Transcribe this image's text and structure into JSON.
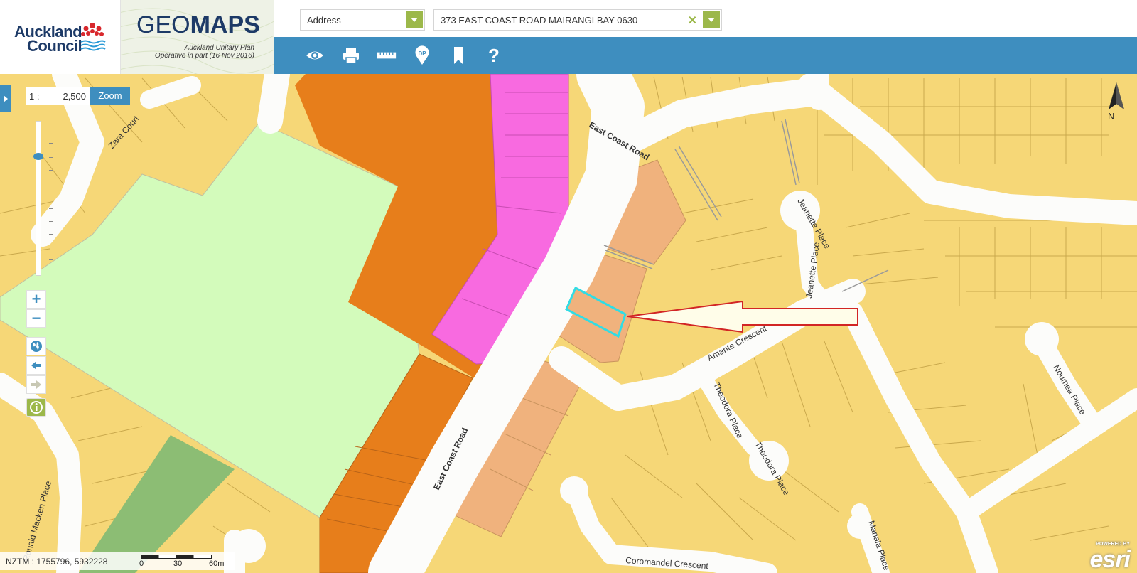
{
  "header": {
    "council_line1": "Auckland",
    "council_line2": "Council",
    "app_title_light": "GEO",
    "app_title_bold": "MAPS",
    "plan_line1": "Auckland Unitary Plan",
    "plan_line2": "Operative in part (16 Nov 2016)"
  },
  "search": {
    "type_value": "Address",
    "query_value": "373 EAST COAST ROAD MAIRANGI BAY 0630"
  },
  "toolbar": {
    "icons": [
      "eye-icon",
      "print-icon",
      "ruler-icon",
      "dp-pin-icon",
      "bookmark-icon",
      "help-icon"
    ],
    "dp_label": "DP",
    "help_label": "?"
  },
  "map_controls": {
    "scale_prefix": "1 :",
    "scale_value": "2,500",
    "zoom_label": "Zoom",
    "zoom_in": "+",
    "zoom_out": "−",
    "north_label": "N"
  },
  "map_labels": {
    "zara_court": "Zara Court",
    "east_coast_road_top": "East Coast Road",
    "east_coast_road_bottom": "East Coast Road",
    "jeanette_place_circle": "Jeanette Place",
    "jeanette_place": "Jeanette Place",
    "amante_crescent": "Amante Crescent",
    "theodora_place": "Theodora Place",
    "theodora_place_circle": "Theodora Place",
    "noumea_place": "Noumea Place",
    "ronald_macken_place": "Ronald Macken Place",
    "coromandel_crescent": "Coromandel Crescent",
    "manaia_place": "Manaia Place"
  },
  "status": {
    "coords": "NZTM : 1755796, 5932228",
    "scalebar_0": "0",
    "scalebar_30": "30",
    "scalebar_60": "60m"
  },
  "branding": {
    "esri_powered": "POWERED BY",
    "esri_word": "esri"
  },
  "colors": {
    "toolbar_blue": "#3e8ebf",
    "accent_green": "#9cb84a",
    "residential_yellow": "#f6d777",
    "business_orange": "#e77e1b",
    "mixed_use_pink": "#f86ae0",
    "open_space_green": "#d3fbbb",
    "dark_green": "#8cbd74",
    "light_orange": "#f0b27d",
    "road_white": "#fcfcfa",
    "selection_cyan": "#31dce4",
    "arrow_red": "#d22525"
  }
}
